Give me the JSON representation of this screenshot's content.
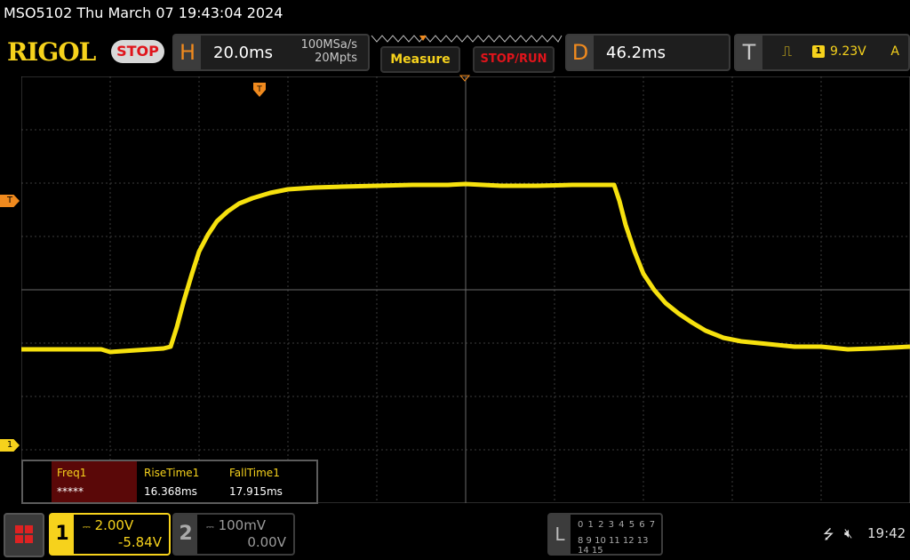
{
  "header": {
    "title": "MSO5102  Thu March 07 19:43:04 2024",
    "logo": "RIGOL",
    "run_state": "STOP"
  },
  "horizontal": {
    "letter": "H",
    "timebase": "20.0ms",
    "sample_rate": "100MSa/s",
    "memory_depth": "20Mpts"
  },
  "buttons": {
    "measure": "Measure",
    "stop_run": "STOP/RUN"
  },
  "delay": {
    "letter": "D",
    "value": "46.2ms"
  },
  "trigger": {
    "letter": "T",
    "channel": "1",
    "level": "9.23V",
    "mode": "A",
    "marker_label": "T"
  },
  "markers": {
    "ch1_ground": "1"
  },
  "measurements": [
    {
      "name": "Freq1",
      "value": "*****"
    },
    {
      "name": "RiseTime1",
      "value": "16.368ms"
    },
    {
      "name": "FallTime1",
      "value": "17.915ms"
    }
  ],
  "channels": [
    {
      "number": "1",
      "scale": "2.00V",
      "offset": "-5.84V",
      "active": true
    },
    {
      "number": "2",
      "scale": "100mV",
      "offset": "0.00V",
      "active": false
    }
  ],
  "logic": {
    "letter": "L",
    "row1": "0 1 2 3  4 5 6 7",
    "row2": "8 9 10 11 12 13 14 15"
  },
  "status_bar": {
    "time": "19:42"
  },
  "colors": {
    "trace": "#f6e10e",
    "accent": "#f08a1e",
    "stop": "#e0141b"
  }
}
